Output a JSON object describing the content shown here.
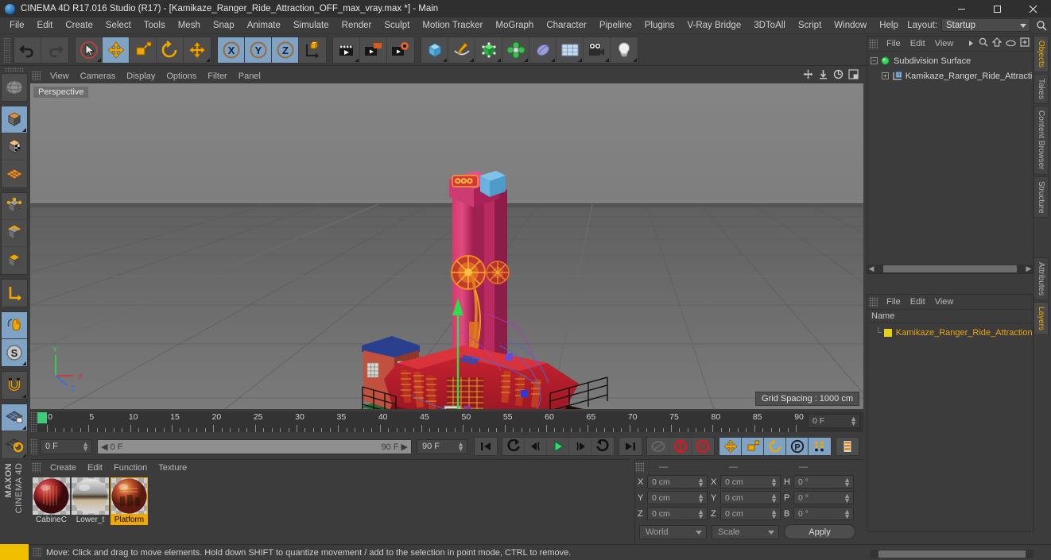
{
  "window": {
    "title": "CINEMA 4D R17.016 Studio (R17) - [Kamikaze_Ranger_Ride_Attraction_OFF_max_vray.max *] - Main",
    "minimize": "minimize-icon",
    "maximize": "maximize-icon",
    "close": "close-icon"
  },
  "menubar": {
    "items": [
      "File",
      "Edit",
      "Create",
      "Select",
      "Tools",
      "Mesh",
      "Snap",
      "Animate",
      "Simulate",
      "Render",
      "Sculpt",
      "Motion Tracker",
      "MoGraph",
      "Character",
      "Pipeline",
      "Plugins",
      "V-Ray Bridge",
      "3DToAll",
      "Script",
      "Window",
      "Help"
    ],
    "layout_label": "Layout:",
    "layout_value": "Startup"
  },
  "toolbar": {
    "groups": [
      {
        "name": "undo-redo",
        "buttons": [
          {
            "name": "undo-button",
            "icon": "undo-arrow-icon",
            "active": false,
            "disabled": false
          },
          {
            "name": "redo-button",
            "icon": "redo-arrow-icon",
            "active": false,
            "disabled": true
          }
        ]
      },
      {
        "name": "transform-tools",
        "buttons": [
          {
            "name": "live-selection-tool",
            "icon": "cursor-circle-icon",
            "active": false,
            "disabled": false
          },
          {
            "name": "move-tool",
            "icon": "move-arrows-icon",
            "active": true,
            "disabled": false
          },
          {
            "name": "scale-tool",
            "icon": "scale-square-icon",
            "active": false,
            "disabled": false
          },
          {
            "name": "rotate-tool",
            "icon": "rotate-circle-icon",
            "active": false,
            "disabled": false
          },
          {
            "name": "free-move-tool",
            "icon": "move-arrows-icon",
            "active": false,
            "disabled": false
          }
        ]
      },
      {
        "name": "axis-locks",
        "buttons": [
          {
            "name": "lock-x-axis",
            "icon": "x-axis-icon",
            "active": true,
            "disabled": false
          },
          {
            "name": "lock-y-axis",
            "icon": "y-axis-icon",
            "active": true,
            "disabled": false
          },
          {
            "name": "lock-z-axis",
            "icon": "z-axis-icon",
            "active": true,
            "disabled": false
          },
          {
            "name": "world-object-coordinates",
            "icon": "world-axis-cube-icon",
            "active": false,
            "disabled": false
          }
        ]
      },
      {
        "name": "render-tools",
        "buttons": [
          {
            "name": "render-view-button",
            "icon": "clapperboard-icon",
            "active": false,
            "disabled": false
          },
          {
            "name": "render-region-button",
            "icon": "clapperboard-region-icon",
            "active": false,
            "disabled": false
          },
          {
            "name": "render-settings-button",
            "icon": "clapperboard-gear-icon",
            "active": false,
            "disabled": false
          }
        ]
      },
      {
        "name": "object-creation",
        "buttons": [
          {
            "name": "add-cube-button",
            "icon": "cube-icon",
            "active": false,
            "disabled": false
          },
          {
            "name": "add-spline-button",
            "icon": "pen-spline-icon",
            "active": false,
            "disabled": false
          },
          {
            "name": "add-generator-button",
            "icon": "green-cube-generator-icon",
            "active": false,
            "disabled": false
          },
          {
            "name": "add-deformer-button",
            "icon": "green-deformer-icon",
            "active": false,
            "disabled": false
          },
          {
            "name": "add-scene-object-button",
            "icon": "blob-icon",
            "active": false,
            "disabled": false
          },
          {
            "name": "add-environment-button",
            "icon": "floor-grid-icon",
            "active": false,
            "disabled": false
          },
          {
            "name": "add-camera-button",
            "icon": "camera-icon",
            "active": false,
            "disabled": false
          },
          {
            "name": "add-light-button",
            "icon": "lightbulb-icon",
            "active": false,
            "disabled": false
          }
        ]
      }
    ]
  },
  "lefttoolbar": {
    "groups": [
      {
        "name": "mode-group-1",
        "buttons": [
          {
            "name": "make-editable-button",
            "icon": "make-editable-sphere-icon",
            "active": false
          }
        ]
      },
      {
        "name": "mode-group-2",
        "buttons": [
          {
            "name": "model-mode-button",
            "icon": "model-cube-icon",
            "active": true
          },
          {
            "name": "texture-mode-button",
            "icon": "texture-checker-cube-icon",
            "active": false
          },
          {
            "name": "uv-mode-button",
            "icon": "uv-mesh-icon",
            "active": false
          }
        ]
      },
      {
        "name": "component-group",
        "buttons": [
          {
            "name": "points-mode-button",
            "icon": "points-cube-icon",
            "active": false
          },
          {
            "name": "edges-mode-button",
            "icon": "edges-cube-icon",
            "active": false
          },
          {
            "name": "polygons-mode-button",
            "icon": "polygons-cube-icon",
            "active": false
          }
        ]
      },
      {
        "name": "axis-group",
        "buttons": [
          {
            "name": "enable-axis-button",
            "icon": "axis-l-icon",
            "active": false
          }
        ]
      },
      {
        "name": "snap-group",
        "buttons": [
          {
            "name": "viewport-solo-button",
            "icon": "mouse-icon",
            "active": true
          },
          {
            "name": "soft-selection-button",
            "icon": "s-circle-icon",
            "active": true
          }
        ]
      },
      {
        "name": "workplane-group",
        "buttons": [
          {
            "name": "snap-magnet-button",
            "icon": "magnet-icon",
            "active": false
          }
        ]
      },
      {
        "name": "workplane-group-2",
        "buttons": [
          {
            "name": "lock-workplane-button",
            "icon": "workplane-lock-icon",
            "active": true
          },
          {
            "name": "align-workplane-button",
            "icon": "workplane-rotate-icon",
            "active": false
          }
        ]
      }
    ],
    "brand_line1": "MAXON",
    "brand_line2": "CINEMA 4D"
  },
  "viewport": {
    "menu": [
      "View",
      "Cameras",
      "Display",
      "Options",
      "Filter",
      "Panel"
    ],
    "icons": [
      "pan-view-icon",
      "dolly-view-icon",
      "rotate-view-icon",
      "maximize-view-icon"
    ],
    "label": "Perspective",
    "grid_spacing": "Grid Spacing : 1000 cm",
    "axis_x_label": "X",
    "axis_y_label": "Y",
    "axis_z_label": "Z",
    "scene_name": "Kamikaze Ranger Ride Attraction"
  },
  "timeline": {
    "ticks": [
      0,
      5,
      10,
      15,
      20,
      25,
      30,
      35,
      40,
      45,
      50,
      55,
      60,
      65,
      70,
      75,
      80,
      85,
      90
    ],
    "min_frame": 0,
    "max_frame": 90,
    "current_frame_field": "0 F"
  },
  "transport": {
    "current_frame": "0 F",
    "range_start": "0 F",
    "range_end": "90 F",
    "end_frame": "90 F",
    "buttons": [
      {
        "name": "go-to-start-button",
        "icon": "skip-start-icon",
        "active": false,
        "disabled": false
      },
      {
        "name": "previous-key-button",
        "icon": "prev-key-icon",
        "active": false,
        "disabled": false
      },
      {
        "name": "step-back-button",
        "icon": "step-back-icon",
        "active": false,
        "disabled": false
      },
      {
        "name": "play-button",
        "icon": "play-icon",
        "active": false,
        "disabled": false
      },
      {
        "name": "step-forward-button",
        "icon": "step-forward-icon",
        "active": false,
        "disabled": false
      },
      {
        "name": "next-key-button",
        "icon": "next-key-icon",
        "active": false,
        "disabled": false
      },
      {
        "name": "go-to-end-button",
        "icon": "skip-end-icon",
        "active": false,
        "disabled": false
      },
      {
        "name": "record-active-objects-button",
        "icon": "record-dot-icon",
        "active": false,
        "disabled": true
      },
      {
        "name": "autokeying-button",
        "icon": "autokey-circle-icon",
        "active": false,
        "disabled": false
      },
      {
        "name": "keyframe-selection-button",
        "icon": "question-circle-icon",
        "active": false,
        "disabled": false
      },
      {
        "name": "position-key-button",
        "icon": "move-arrows-icon",
        "active": true,
        "disabled": false
      },
      {
        "name": "scale-key-button",
        "icon": "scale-square-icon",
        "active": true,
        "disabled": false
      },
      {
        "name": "rotation-key-button",
        "icon": "rotate-circle-icon",
        "active": true,
        "disabled": false
      },
      {
        "name": "parameter-key-button",
        "icon": "p-circle-icon",
        "active": true,
        "disabled": false
      },
      {
        "name": "point-level-animation-button",
        "icon": "dots-grid-icon",
        "active": true,
        "disabled": false
      }
    ],
    "layers_button": "layers-stack-icon"
  },
  "materials": {
    "menu": [
      "Create",
      "Edit",
      "Function",
      "Texture"
    ],
    "items": [
      {
        "name": "CabineC",
        "selected": false,
        "color": "#a8302a"
      },
      {
        "name": "Lower_t",
        "selected": false,
        "color": "#b9b9b9"
      },
      {
        "name": "Platform",
        "selected": true,
        "color": "#b5502a"
      }
    ]
  },
  "coordinates": {
    "headers": [
      "—",
      "—",
      "—"
    ],
    "rows": [
      {
        "axis1": "X",
        "value1": "0 cm",
        "axis2": "X",
        "value2": "0 cm",
        "axis3": "H",
        "value3": "0 °"
      },
      {
        "axis1": "Y",
        "value1": "0 cm",
        "axis2": "Y",
        "value2": "0 cm",
        "axis3": "P",
        "value3": "0 °"
      },
      {
        "axis1": "Z",
        "value1": "0 cm",
        "axis2": "Z",
        "value2": "0 cm",
        "axis3": "B",
        "value3": "0 °"
      }
    ],
    "system": "World",
    "mode": "Scale",
    "apply": "Apply"
  },
  "objects_panel": {
    "menu": [
      "File",
      "Edit",
      "View"
    ],
    "icons": [
      "more-arrow-icon",
      "search-icon",
      "home-icon",
      "eye-icon",
      "expand-icon"
    ],
    "tree": [
      {
        "label": "Subdivision Surface",
        "depth": 0,
        "icon": "subdivision-surface-icon",
        "color": "#d8d8d8"
      },
      {
        "label": "Kamikaze_Ranger_Ride_Attractio",
        "depth": 1,
        "icon": "null-object-icon",
        "color": "#d8d8d8"
      }
    ]
  },
  "attributes_panel": {
    "menu": [
      "File",
      "Edit",
      "View"
    ],
    "column_header": "Name",
    "rows": [
      {
        "label": "Kamikaze_Ranger_Ride_Attraction",
        "color": "#e8a317",
        "swatch": "#e8d018"
      }
    ]
  },
  "vertical_tabs": [
    {
      "label": "Objects",
      "active": true
    },
    {
      "label": "Takes",
      "active": false
    },
    {
      "label": "Content Browser",
      "active": false
    },
    {
      "label": "Structure",
      "active": false
    },
    {
      "label": "Attributes",
      "active": false
    },
    {
      "label": "Layers",
      "active": true
    }
  ],
  "statusbar": {
    "text": "Move: Click and drag to move elements. Hold down SHIFT to quantize movement / add to the selection in point mode, CTRL to remove."
  },
  "colors": {
    "accent_orange": "#f0a800",
    "active_blue": "#7ea3c4",
    "panel_bg": "#3c3c3c",
    "viewport_sky": "#808080",
    "viewport_ground": "#6e6e6e",
    "model_red": "#c0242e",
    "model_pink": "#d4427a"
  }
}
